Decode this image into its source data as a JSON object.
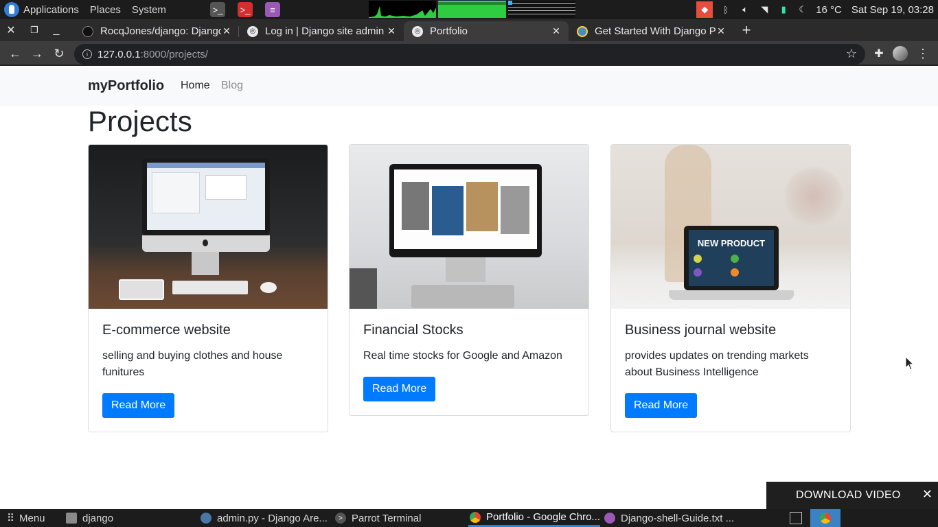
{
  "desktop_panel": {
    "menus": [
      "Applications",
      "Places",
      "System"
    ],
    "temperature": "16 °C",
    "datetime": "Sat Sep 19, 03:28"
  },
  "browser": {
    "tabs": [
      {
        "title": "RocqJones/django: Django",
        "active": false
      },
      {
        "title": "Log in | Django site admin",
        "active": false
      },
      {
        "title": "Portfolio",
        "active": true
      },
      {
        "title": "Get Started With Django P",
        "active": false
      }
    ],
    "url_host": "127.0.0.1",
    "url_path": ":8000/projects/"
  },
  "site": {
    "brand": "myPortfolio",
    "nav": [
      "Home",
      "Blog"
    ],
    "page_title": "Projects",
    "projects": [
      {
        "title": "E-commerce website",
        "description": "selling and buying clothes and house funitures",
        "button": "Read More"
      },
      {
        "title": "Financial Stocks",
        "description": "Real time stocks for Google and Amazon",
        "button": "Read More"
      },
      {
        "title": "Business journal website",
        "description": "provides updates on trending markets about Business Intelligence",
        "button": "Read More"
      }
    ],
    "card3_screen_text": "NEW PRODUCT"
  },
  "overlay": {
    "download_label": "DOWNLOAD VIDEO"
  },
  "taskbar": {
    "menu_label": "Menu",
    "items": [
      {
        "label": "django"
      },
      {
        "label": "admin.py - Django Are..."
      },
      {
        "label": "Parrot Terminal"
      },
      {
        "label": "Portfolio - Google Chro..."
      },
      {
        "label": "Django-shell-Guide.txt ..."
      }
    ]
  },
  "colors": {
    "primary": "#007bff",
    "navbar_bg": "#f8f9fa",
    "panel_bg": "#1c1c1c"
  }
}
